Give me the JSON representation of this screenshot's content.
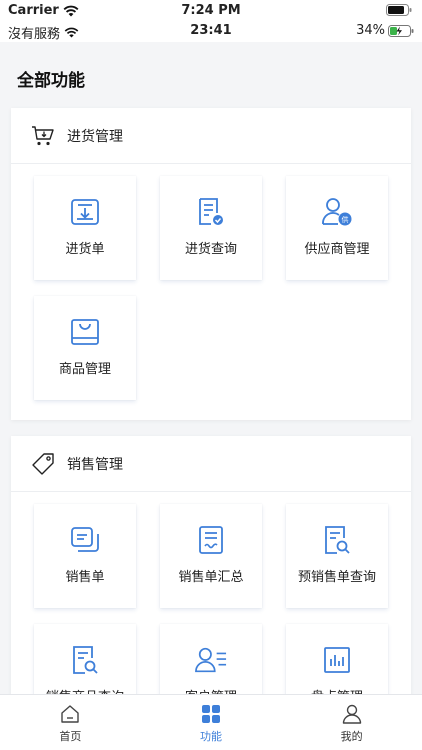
{
  "status_outer": {
    "carrier": "Carrier",
    "time": "7:24 PM"
  },
  "status_inner": {
    "carrier": "沒有服務",
    "time": "23:41",
    "battery": "34%"
  },
  "page_title": "全部功能",
  "colors": {
    "accent": "#3e7fd9",
    "background": "#f4f5f7"
  },
  "sections": [
    {
      "title": "进货管理",
      "icon": "cart-icon",
      "items": [
        {
          "label": "进货单",
          "icon": "inbox-download-icon"
        },
        {
          "label": "进货查询",
          "icon": "document-check-icon"
        },
        {
          "label": "供应商管理",
          "icon": "supplier-user-icon"
        },
        {
          "label": "商品管理",
          "icon": "shopping-bag-icon"
        }
      ]
    },
    {
      "title": "销售管理",
      "icon": "price-tag-icon",
      "items": [
        {
          "label": "销售单",
          "icon": "copy-docs-icon"
        },
        {
          "label": "销售单汇总",
          "icon": "document-wave-icon"
        },
        {
          "label": "预销售单查询",
          "icon": "document-search-icon"
        },
        {
          "label": "销售商品查询",
          "icon": "document-search-icon"
        },
        {
          "label": "客户管理",
          "icon": "user-list-icon"
        },
        {
          "label": "盘点管理",
          "icon": "bar-chart-icon"
        }
      ]
    }
  ],
  "tabs": [
    {
      "label": "首页",
      "icon": "home-icon",
      "active": false
    },
    {
      "label": "功能",
      "icon": "grid-icon",
      "active": true
    },
    {
      "label": "我的",
      "icon": "person-icon",
      "active": false
    }
  ]
}
